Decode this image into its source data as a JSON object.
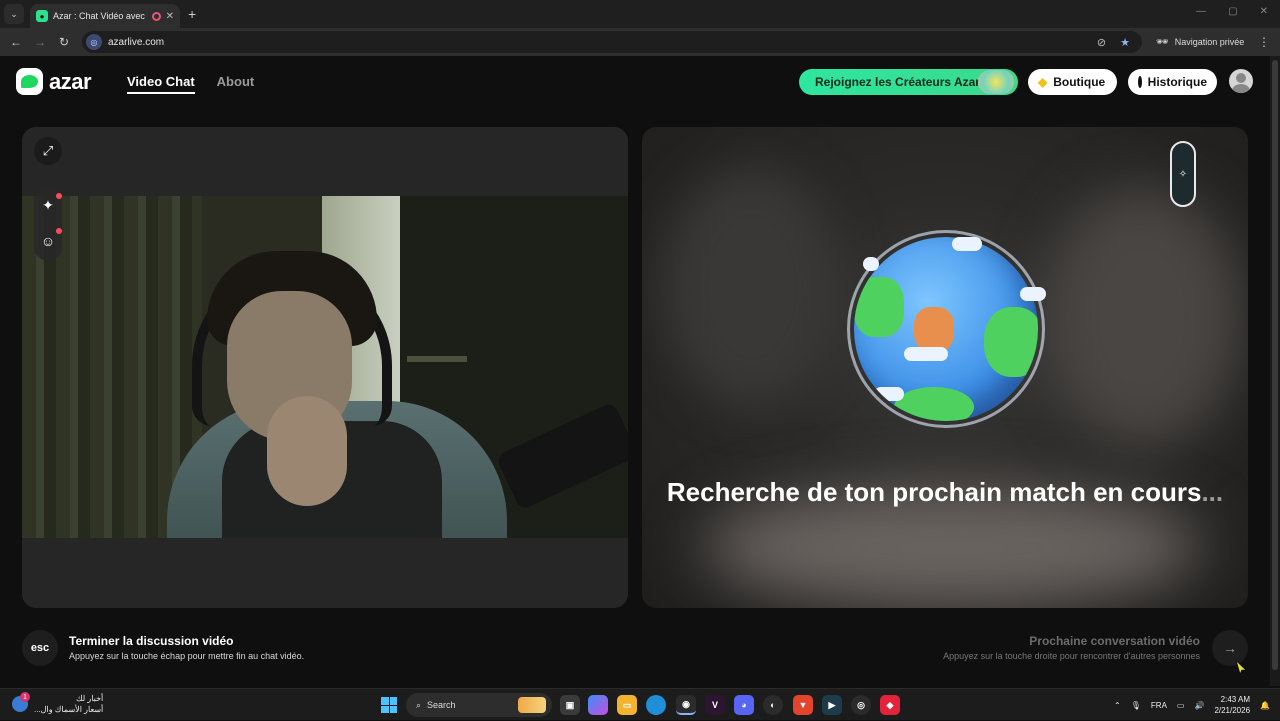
{
  "browser": {
    "tab_title": "Azar : Chat Vidéo avec de n",
    "url": "azarlive.com",
    "private_label": "Navigation privée"
  },
  "header": {
    "logo_text": "azar",
    "nav": [
      "Video Chat",
      "About"
    ],
    "creators_label": "Rejoignez les Créateurs Azar",
    "boutique_label": "Boutique",
    "historique_label": "Historique"
  },
  "match": {
    "searching_text": "Recherche de ton prochain match en cours",
    "searching_dots": "..."
  },
  "controls": {
    "esc_label": "esc",
    "end_title": "Terminer la discussion vidéo",
    "end_sub": "Appuyez sur la touche échap pour mettre fin au chat vidéo.",
    "next_title": "Prochaine conversation vidéo",
    "next_sub": "Appuyez sur la touche droite pour rencontrer d'autres personnes"
  },
  "taskbar": {
    "news_line1": "أخبار لك",
    "news_line2": "أسعار الأسماك وال...",
    "news_badge": "1",
    "search_label": "Search",
    "language": "FRA",
    "time": "2:43 AM",
    "date": "2/21/2026"
  },
  "colors": {
    "accent_green": "#2ee6a0",
    "notification_red": "#ff4b5c"
  }
}
